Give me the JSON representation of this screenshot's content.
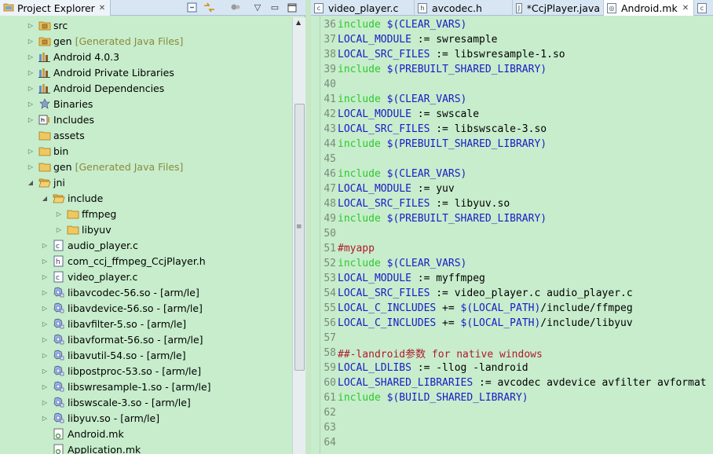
{
  "explorer": {
    "title": "Project Explorer",
    "items": [
      {
        "label": "src",
        "decoration": "",
        "indent": 0,
        "toggle": "collapsed",
        "icon": "package-folder-icon"
      },
      {
        "label": "gen",
        "decoration": "[Generated Java Files]",
        "indent": 0,
        "toggle": "collapsed",
        "icon": "package-folder-icon"
      },
      {
        "label": "Android 4.0.3",
        "decoration": "",
        "indent": 0,
        "toggle": "collapsed",
        "icon": "library-icon"
      },
      {
        "label": "Android Private Libraries",
        "decoration": "",
        "indent": 0,
        "toggle": "collapsed",
        "icon": "library-icon"
      },
      {
        "label": "Android Dependencies",
        "decoration": "",
        "indent": 0,
        "toggle": "collapsed",
        "icon": "library-icon"
      },
      {
        "label": "Binaries",
        "decoration": "",
        "indent": 0,
        "toggle": "collapsed",
        "icon": "binaries-icon"
      },
      {
        "label": "Includes",
        "decoration": "",
        "indent": 0,
        "toggle": "collapsed",
        "icon": "includes-icon"
      },
      {
        "label": "assets",
        "decoration": "",
        "indent": 0,
        "toggle": "none",
        "icon": "folder-icon"
      },
      {
        "label": "bin",
        "decoration": "",
        "indent": 0,
        "toggle": "collapsed",
        "icon": "folder-icon"
      },
      {
        "label": "gen",
        "decoration": "[Generated Java Files]",
        "indent": 0,
        "toggle": "collapsed",
        "icon": "folder-icon"
      },
      {
        "label": "jni",
        "decoration": "",
        "indent": 0,
        "toggle": "expanded",
        "icon": "folder-open-icon"
      },
      {
        "label": "include",
        "decoration": "",
        "indent": 1,
        "toggle": "expanded",
        "icon": "folder-open-icon"
      },
      {
        "label": "ffmpeg",
        "decoration": "",
        "indent": 2,
        "toggle": "collapsed",
        "icon": "folder-icon"
      },
      {
        "label": "libyuv",
        "decoration": "",
        "indent": 2,
        "toggle": "collapsed",
        "icon": "folder-icon"
      },
      {
        "label": "audio_player.c",
        "decoration": "",
        "indent": 1,
        "toggle": "collapsed",
        "icon": "c-file-icon"
      },
      {
        "label": "com_ccj_ffmpeg_CcjPlayer.h",
        "decoration": "",
        "indent": 1,
        "toggle": "collapsed",
        "icon": "h-file-icon"
      },
      {
        "label": "video_player.c",
        "decoration": "",
        "indent": 1,
        "toggle": "collapsed",
        "icon": "c-file-icon"
      },
      {
        "label": "libavcodec-56.so - [arm/le]",
        "decoration": "",
        "indent": 1,
        "toggle": "collapsed",
        "icon": "shared-lib-icon"
      },
      {
        "label": "libavdevice-56.so - [arm/le]",
        "decoration": "",
        "indent": 1,
        "toggle": "collapsed",
        "icon": "shared-lib-icon"
      },
      {
        "label": "libavfilter-5.so - [arm/le]",
        "decoration": "",
        "indent": 1,
        "toggle": "collapsed",
        "icon": "shared-lib-icon"
      },
      {
        "label": "libavformat-56.so - [arm/le]",
        "decoration": "",
        "indent": 1,
        "toggle": "collapsed",
        "icon": "shared-lib-icon"
      },
      {
        "label": "libavutil-54.so - [arm/le]",
        "decoration": "",
        "indent": 1,
        "toggle": "collapsed",
        "icon": "shared-lib-icon"
      },
      {
        "label": "libpostproc-53.so - [arm/le]",
        "decoration": "",
        "indent": 1,
        "toggle": "collapsed",
        "icon": "shared-lib-icon"
      },
      {
        "label": "libswresample-1.so - [arm/le]",
        "decoration": "",
        "indent": 1,
        "toggle": "collapsed",
        "icon": "shared-lib-icon"
      },
      {
        "label": "libswscale-3.so - [arm/le]",
        "decoration": "",
        "indent": 1,
        "toggle": "collapsed",
        "icon": "shared-lib-icon"
      },
      {
        "label": "libyuv.so - [arm/le]",
        "decoration": "",
        "indent": 1,
        "toggle": "collapsed",
        "icon": "shared-lib-icon"
      },
      {
        "label": "Android.mk",
        "decoration": "",
        "indent": 1,
        "toggle": "none",
        "icon": "mk-file-icon"
      },
      {
        "label": "Application.mk",
        "decoration": "",
        "indent": 1,
        "toggle": "none",
        "icon": "mk-file-icon"
      }
    ]
  },
  "editor": {
    "tabs": [
      {
        "label": "video_player.c",
        "active": false,
        "closable": false
      },
      {
        "label": "avcodec.h",
        "active": false,
        "closable": false
      },
      {
        "label": "*CcjPlayer.java",
        "active": false,
        "closable": false
      },
      {
        "label": "Android.mk",
        "active": true,
        "closable": true
      },
      {
        "label": "",
        "active": false,
        "closable": false
      }
    ],
    "lines": [
      {
        "n": "36",
        "segs": [
          [
            "kw",
            "include "
          ],
          [
            "id",
            "$(CLEAR_VARS)"
          ]
        ]
      },
      {
        "n": "37",
        "segs": [
          [
            "id",
            "LOCAL_MODULE"
          ],
          [
            "tx",
            " := swresample"
          ]
        ]
      },
      {
        "n": "38",
        "segs": [
          [
            "id",
            "LOCAL_SRC_FILES"
          ],
          [
            "tx",
            " := libswresample-1.so"
          ]
        ]
      },
      {
        "n": "39",
        "segs": [
          [
            "kw",
            "include "
          ],
          [
            "id",
            "$(PREBUILT_SHARED_LIBRARY)"
          ]
        ]
      },
      {
        "n": "40",
        "segs": []
      },
      {
        "n": "41",
        "segs": [
          [
            "kw",
            "include "
          ],
          [
            "id",
            "$(CLEAR_VARS)"
          ]
        ]
      },
      {
        "n": "42",
        "segs": [
          [
            "id",
            "LOCAL_MODULE"
          ],
          [
            "tx",
            " := swscale"
          ]
        ]
      },
      {
        "n": "43",
        "segs": [
          [
            "id",
            "LOCAL_SRC_FILES"
          ],
          [
            "tx",
            " := libswscale-3.so"
          ]
        ]
      },
      {
        "n": "44",
        "segs": [
          [
            "kw",
            "include "
          ],
          [
            "id",
            "$(PREBUILT_SHARED_LIBRARY)"
          ]
        ]
      },
      {
        "n": "45",
        "segs": []
      },
      {
        "n": "46",
        "segs": [
          [
            "kw",
            "include "
          ],
          [
            "id",
            "$(CLEAR_VARS)"
          ]
        ]
      },
      {
        "n": "47",
        "segs": [
          [
            "id",
            "LOCAL_MODULE"
          ],
          [
            "tx",
            " := yuv"
          ]
        ]
      },
      {
        "n": "48",
        "segs": [
          [
            "id",
            "LOCAL_SRC_FILES"
          ],
          [
            "tx",
            " := libyuv.so"
          ]
        ]
      },
      {
        "n": "49",
        "segs": [
          [
            "kw",
            "include "
          ],
          [
            "id",
            "$(PREBUILT_SHARED_LIBRARY)"
          ]
        ]
      },
      {
        "n": "50",
        "segs": []
      },
      {
        "n": "51",
        "segs": [
          [
            "cmt",
            "#myapp"
          ]
        ]
      },
      {
        "n": "52",
        "segs": [
          [
            "kw",
            "include "
          ],
          [
            "id",
            "$(CLEAR_VARS)"
          ]
        ]
      },
      {
        "n": "53",
        "segs": [
          [
            "id",
            "LOCAL_MODULE"
          ],
          [
            "tx",
            " := myffmpeg"
          ]
        ]
      },
      {
        "n": "54",
        "segs": [
          [
            "id",
            "LOCAL_SRC_FILES"
          ],
          [
            "tx",
            " := video_player.c audio_player.c"
          ]
        ]
      },
      {
        "n": "55",
        "segs": [
          [
            "id",
            "LOCAL_C_INCLUDES"
          ],
          [
            "tx",
            " += "
          ],
          [
            "id",
            "$(LOCAL_PATH)"
          ],
          [
            "tx",
            "/include/ffmpeg"
          ]
        ]
      },
      {
        "n": "56",
        "segs": [
          [
            "id",
            "LOCAL_C_INCLUDES"
          ],
          [
            "tx",
            " += "
          ],
          [
            "id",
            "$(LOCAL_PATH)"
          ],
          [
            "tx",
            "/include/libyuv"
          ]
        ]
      },
      {
        "n": "57",
        "segs": []
      },
      {
        "n": "58",
        "segs": [
          [
            "cmt",
            "##-landroid参数 for native windows"
          ]
        ]
      },
      {
        "n": "59",
        "segs": [
          [
            "id",
            "LOCAL_LDLIBS"
          ],
          [
            "tx",
            " := -llog -landroid"
          ]
        ]
      },
      {
        "n": "60",
        "segs": [
          [
            "id",
            "LOCAL_SHARED_LIBRARIES"
          ],
          [
            "tx",
            " := avcodec avdevice avfilter avformat"
          ]
        ]
      },
      {
        "n": "61",
        "segs": [
          [
            "kw",
            "include "
          ],
          [
            "id",
            "$(BUILD_SHARED_LIBRARY)"
          ]
        ]
      },
      {
        "n": "62",
        "segs": []
      },
      {
        "n": "63",
        "segs": []
      },
      {
        "n": "64",
        "segs": []
      }
    ]
  },
  "colors": {
    "background": "#c7edcc",
    "keyword": "#2ec82e",
    "identifier": "#1a1ac8",
    "comment": "#b2182b",
    "decoration": "#8a8a3a"
  }
}
